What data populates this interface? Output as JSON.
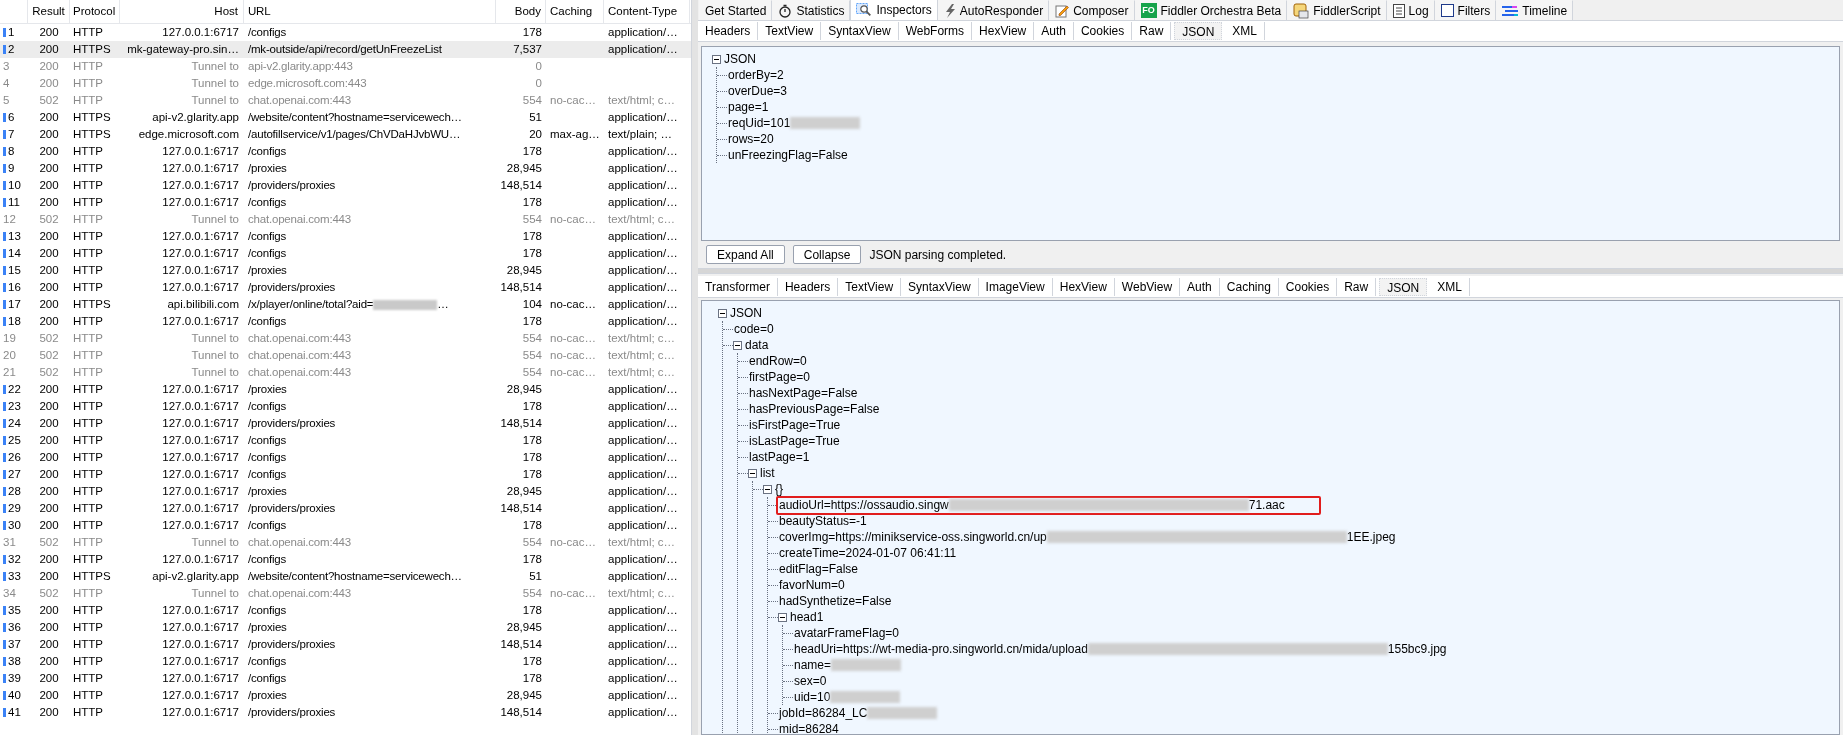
{
  "sessions": {
    "columns": [
      {
        "kind": "num"
      },
      {
        "kind": "result",
        "label": "Result"
      },
      {
        "kind": "protocol",
        "label": "Protocol"
      },
      {
        "kind": "host",
        "label": "Host"
      },
      {
        "kind": "url",
        "label": "URL"
      },
      {
        "kind": "body",
        "label": "Body"
      },
      {
        "kind": "caching",
        "label": "Caching"
      },
      {
        "kind": "content_type",
        "label": "Content-Type"
      }
    ],
    "rows": [
      {
        "num": "1",
        "result": "200",
        "protocol": "HTTP",
        "host": "127.0.0.1:6717",
        "url": "/configs",
        "body": "178",
        "caching": "",
        "content_type": "application/…",
        "kind": "normal",
        "selected": false
      },
      {
        "num": "2",
        "result": "200",
        "protocol": "HTTPS",
        "host": "mk-gateway-pro.sin…",
        "url": "/mk-outside/api/record/getUnFreezeList",
        "body": "7,537",
        "caching": "",
        "content_type": "application/…",
        "kind": "normal",
        "selected": true
      },
      {
        "num": "3",
        "result": "200",
        "protocol": "HTTP",
        "host": "Tunnel to",
        "url": "api-v2.glarity.app:443",
        "body": "0",
        "caching": "",
        "content_type": "",
        "kind": "tunnel",
        "selected": false
      },
      {
        "num": "4",
        "result": "200",
        "protocol": "HTTP",
        "host": "Tunnel to",
        "url": "edge.microsoft.com:443",
        "body": "0",
        "caching": "",
        "content_type": "",
        "kind": "tunnel",
        "selected": false
      },
      {
        "num": "5",
        "result": "502",
        "protocol": "HTTP",
        "host": "Tunnel to",
        "url": "chat.openai.com:443",
        "body": "554",
        "caching": "no-cac…",
        "content_type": "text/html; c…",
        "kind": "tunnel",
        "selected": false
      },
      {
        "num": "6",
        "result": "200",
        "protocol": "HTTPS",
        "host": "api-v2.glarity.app",
        "url": "/website/content?hostname=servicewech…",
        "body": "51",
        "caching": "",
        "content_type": "application/…",
        "kind": "normal",
        "selected": false
      },
      {
        "num": "7",
        "result": "200",
        "protocol": "HTTPS",
        "host": "edge.microsoft.com",
        "url": "/autofillservice/v1/pages/ChVDaHJvbWU…",
        "body": "20",
        "caching": "max-ag…",
        "content_type": "text/plain; …",
        "kind": "normal",
        "selected": false
      },
      {
        "num": "8",
        "result": "200",
        "protocol": "HTTP",
        "host": "127.0.0.1:6717",
        "url": "/configs",
        "body": "178",
        "caching": "",
        "content_type": "application/…",
        "kind": "normal",
        "selected": false
      },
      {
        "num": "9",
        "result": "200",
        "protocol": "HTTP",
        "host": "127.0.0.1:6717",
        "url": "/proxies",
        "body": "28,945",
        "caching": "",
        "content_type": "application/…",
        "kind": "normal",
        "selected": false
      },
      {
        "num": "10",
        "result": "200",
        "protocol": "HTTP",
        "host": "127.0.0.1:6717",
        "url": "/providers/proxies",
        "body": "148,514",
        "caching": "",
        "content_type": "application/…",
        "kind": "normal",
        "selected": false
      },
      {
        "num": "11",
        "result": "200",
        "protocol": "HTTP",
        "host": "127.0.0.1:6717",
        "url": "/configs",
        "body": "178",
        "caching": "",
        "content_type": "application/…",
        "kind": "normal",
        "selected": false
      },
      {
        "num": "12",
        "result": "502",
        "protocol": "HTTP",
        "host": "Tunnel to",
        "url": "chat.openai.com:443",
        "body": "554",
        "caching": "no-cac…",
        "content_type": "text/html; c…",
        "kind": "tunnel",
        "selected": false
      },
      {
        "num": "13",
        "result": "200",
        "protocol": "HTTP",
        "host": "127.0.0.1:6717",
        "url": "/configs",
        "body": "178",
        "caching": "",
        "content_type": "application/…",
        "kind": "normal",
        "selected": false
      },
      {
        "num": "14",
        "result": "200",
        "protocol": "HTTP",
        "host": "127.0.0.1:6717",
        "url": "/configs",
        "body": "178",
        "caching": "",
        "content_type": "application/…",
        "kind": "normal",
        "selected": false
      },
      {
        "num": "15",
        "result": "200",
        "protocol": "HTTP",
        "host": "127.0.0.1:6717",
        "url": "/proxies",
        "body": "28,945",
        "caching": "",
        "content_type": "application/…",
        "kind": "normal",
        "selected": false
      },
      {
        "num": "16",
        "result": "200",
        "protocol": "HTTP",
        "host": "127.0.0.1:6717",
        "url": "/providers/proxies",
        "body": "148,514",
        "caching": "",
        "content_type": "application/…",
        "kind": "normal",
        "selected": false
      },
      {
        "num": "17",
        "result": "200",
        "protocol": "HTTPS",
        "host": "api.bilibili.com",
        "url": "/x/player/online/total?aid=",
        "url_tail": "…",
        "body": "104",
        "caching": "no-cac…",
        "content_type": "application/…",
        "kind": "normal",
        "selected": false
      },
      {
        "num": "18",
        "result": "200",
        "protocol": "HTTP",
        "host": "127.0.0.1:6717",
        "url": "/configs",
        "body": "178",
        "caching": "",
        "content_type": "application/…",
        "kind": "normal",
        "selected": false
      },
      {
        "num": "19",
        "result": "502",
        "protocol": "HTTP",
        "host": "Tunnel to",
        "url": "chat.openai.com:443",
        "body": "554",
        "caching": "no-cac…",
        "content_type": "text/html; c…",
        "kind": "tunnel",
        "selected": false
      },
      {
        "num": "20",
        "result": "502",
        "protocol": "HTTP",
        "host": "Tunnel to",
        "url": "chat.openai.com:443",
        "body": "554",
        "caching": "no-cac…",
        "content_type": "text/html; c…",
        "kind": "tunnel",
        "selected": false
      },
      {
        "num": "21",
        "result": "502",
        "protocol": "HTTP",
        "host": "Tunnel to",
        "url": "chat.openai.com:443",
        "body": "554",
        "caching": "no-cac…",
        "content_type": "text/html; c…",
        "kind": "tunnel",
        "selected": false
      },
      {
        "num": "22",
        "result": "200",
        "protocol": "HTTP",
        "host": "127.0.0.1:6717",
        "url": "/proxies",
        "body": "28,945",
        "caching": "",
        "content_type": "application/…",
        "kind": "normal",
        "selected": false
      },
      {
        "num": "23",
        "result": "200",
        "protocol": "HTTP",
        "host": "127.0.0.1:6717",
        "url": "/configs",
        "body": "178",
        "caching": "",
        "content_type": "application/…",
        "kind": "normal",
        "selected": false
      },
      {
        "num": "24",
        "result": "200",
        "protocol": "HTTP",
        "host": "127.0.0.1:6717",
        "url": "/providers/proxies",
        "body": "148,514",
        "caching": "",
        "content_type": "application/…",
        "kind": "normal",
        "selected": false
      },
      {
        "num": "25",
        "result": "200",
        "protocol": "HTTP",
        "host": "127.0.0.1:6717",
        "url": "/configs",
        "body": "178",
        "caching": "",
        "content_type": "application/…",
        "kind": "normal",
        "selected": false
      },
      {
        "num": "26",
        "result": "200",
        "protocol": "HTTP",
        "host": "127.0.0.1:6717",
        "url": "/configs",
        "body": "178",
        "caching": "",
        "content_type": "application/…",
        "kind": "normal",
        "selected": false
      },
      {
        "num": "27",
        "result": "200",
        "protocol": "HTTP",
        "host": "127.0.0.1:6717",
        "url": "/configs",
        "body": "178",
        "caching": "",
        "content_type": "application/…",
        "kind": "normal",
        "selected": false
      },
      {
        "num": "28",
        "result": "200",
        "protocol": "HTTP",
        "host": "127.0.0.1:6717",
        "url": "/proxies",
        "body": "28,945",
        "caching": "",
        "content_type": "application/…",
        "kind": "normal",
        "selected": false
      },
      {
        "num": "29",
        "result": "200",
        "protocol": "HTTP",
        "host": "127.0.0.1:6717",
        "url": "/providers/proxies",
        "body": "148,514",
        "caching": "",
        "content_type": "application/…",
        "kind": "normal",
        "selected": false
      },
      {
        "num": "30",
        "result": "200",
        "protocol": "HTTP",
        "host": "127.0.0.1:6717",
        "url": "/configs",
        "body": "178",
        "caching": "",
        "content_type": "application/…",
        "kind": "normal",
        "selected": false
      },
      {
        "num": "31",
        "result": "502",
        "protocol": "HTTP",
        "host": "Tunnel to",
        "url": "chat.openai.com:443",
        "body": "554",
        "caching": "no-cac…",
        "content_type": "text/html; c…",
        "kind": "tunnel",
        "selected": false
      },
      {
        "num": "32",
        "result": "200",
        "protocol": "HTTP",
        "host": "127.0.0.1:6717",
        "url": "/configs",
        "body": "178",
        "caching": "",
        "content_type": "application/…",
        "kind": "normal",
        "selected": false
      },
      {
        "num": "33",
        "result": "200",
        "protocol": "HTTPS",
        "host": "api-v2.glarity.app",
        "url": "/website/content?hostname=servicewech…",
        "body": "51",
        "caching": "",
        "content_type": "application/…",
        "kind": "normal",
        "selected": false
      },
      {
        "num": "34",
        "result": "502",
        "protocol": "HTTP",
        "host": "Tunnel to",
        "url": "chat.openai.com:443",
        "body": "554",
        "caching": "no-cac…",
        "content_type": "text/html; c…",
        "kind": "tunnel",
        "selected": false
      },
      {
        "num": "35",
        "result": "200",
        "protocol": "HTTP",
        "host": "127.0.0.1:6717",
        "url": "/configs",
        "body": "178",
        "caching": "",
        "content_type": "application/…",
        "kind": "normal",
        "selected": false
      },
      {
        "num": "36",
        "result": "200",
        "protocol": "HTTP",
        "host": "127.0.0.1:6717",
        "url": "/proxies",
        "body": "28,945",
        "caching": "",
        "content_type": "application/…",
        "kind": "normal",
        "selected": false
      },
      {
        "num": "37",
        "result": "200",
        "protocol": "HTTP",
        "host": "127.0.0.1:6717",
        "url": "/providers/proxies",
        "body": "148,514",
        "caching": "",
        "content_type": "application/…",
        "kind": "normal",
        "selected": false
      },
      {
        "num": "38",
        "result": "200",
        "protocol": "HTTP",
        "host": "127.0.0.1:6717",
        "url": "/configs",
        "body": "178",
        "caching": "",
        "content_type": "application/…",
        "kind": "normal",
        "selected": false
      },
      {
        "num": "39",
        "result": "200",
        "protocol": "HTTP",
        "host": "127.0.0.1:6717",
        "url": "/configs",
        "body": "178",
        "caching": "",
        "content_type": "application/…",
        "kind": "normal",
        "selected": false
      },
      {
        "num": "40",
        "result": "200",
        "protocol": "HTTP",
        "host": "127.0.0.1:6717",
        "url": "/proxies",
        "body": "28,945",
        "caching": "",
        "content_type": "application/…",
        "kind": "normal",
        "selected": false
      },
      {
        "num": "41",
        "result": "200",
        "protocol": "HTTP",
        "host": "127.0.0.1:6717",
        "url": "/providers/proxies",
        "body": "148,514",
        "caching": "",
        "content_type": "application/…",
        "kind": "normal",
        "selected": false
      }
    ]
  },
  "main_tabs": [
    {
      "label": "Get Started",
      "selected": false
    },
    {
      "label": "Statistics",
      "selected": false
    },
    {
      "label": "Inspectors",
      "selected": true
    },
    {
      "label": "AutoResponder",
      "selected": false
    },
    {
      "label": "Composer",
      "selected": false
    },
    {
      "label": "Fiddler Orchestra Beta",
      "badge": "FO",
      "selected": false
    },
    {
      "label": "FiddlerScript",
      "selected": false
    },
    {
      "label": "Log",
      "selected": false
    },
    {
      "label": "Filters",
      "selected": false
    },
    {
      "label": "Timeline",
      "selected": false
    }
  ],
  "request": {
    "tabs": [
      {
        "label": "Headers",
        "selected": false
      },
      {
        "label": "TextView",
        "selected": false
      },
      {
        "label": "SyntaxView",
        "selected": false
      },
      {
        "label": "WebForms",
        "selected": false
      },
      {
        "label": "HexView",
        "selected": false
      },
      {
        "label": "Auth",
        "selected": false
      },
      {
        "label": "Cookies",
        "selected": false
      },
      {
        "label": "Raw",
        "selected": false
      },
      {
        "label": "JSON",
        "selected": true
      },
      {
        "label": "XML",
        "selected": false
      }
    ],
    "tree": {
      "text": "JSON",
      "expanded": true,
      "children": [
        {
          "text": "orderBy=2"
        },
        {
          "text": "overDue=3"
        },
        {
          "text": "page=1"
        },
        {
          "text": "reqUid=101",
          "redacted": true
        },
        {
          "text": "rows=20"
        },
        {
          "text": "unFreezingFlag=False"
        }
      ]
    },
    "buttons": [
      "Expand All",
      "Collapse"
    ],
    "status": "JSON parsing completed."
  },
  "response": {
    "tabs": [
      {
        "label": "Transformer",
        "selected": false
      },
      {
        "label": "Headers",
        "selected": false
      },
      {
        "label": "TextView",
        "selected": false
      },
      {
        "label": "SyntaxView",
        "selected": false
      },
      {
        "label": "ImageView",
        "selected": false
      },
      {
        "label": "HexView",
        "selected": false
      },
      {
        "label": "WebView",
        "selected": false
      },
      {
        "label": "Auth",
        "selected": false
      },
      {
        "label": "Caching",
        "selected": false
      },
      {
        "label": "Cookies",
        "selected": false
      },
      {
        "label": "Raw",
        "selected": false
      },
      {
        "label": "JSON",
        "selected": true
      },
      {
        "label": "XML",
        "selected": false
      }
    ],
    "tree": {
      "text": "JSON",
      "expanded": true,
      "children": [
        {
          "text": "code=0"
        },
        {
          "text": "data",
          "expanded": true,
          "children": [
            {
              "text": "endRow=0"
            },
            {
              "text": "firstPage=0"
            },
            {
              "text": "hasNextPage=False"
            },
            {
              "text": "hasPreviousPage=False"
            },
            {
              "text": "isFirstPage=True"
            },
            {
              "text": "isLastPage=True"
            },
            {
              "text": "lastPage=1"
            },
            {
              "text": "list",
              "expanded": true,
              "children": [
                {
                  "text": "{}",
                  "expanded": true,
                  "children": [
                    {
                      "text": "audioUrl=https://ossaudio.singw",
                      "redacted": true,
                      "tail": "71.aac",
                      "highlighted": true
                    },
                    {
                      "text": "beautyStatus=-1",
                      "highlighted": false
                    },
                    {
                      "text": "coverImg=https://minikservice-oss.singworld.cn/up",
                      "redacted": true,
                      "tail": "1EE.jpeg",
                      "highlighted": false
                    },
                    {
                      "text": "createTime=2024-01-07 06:41:11",
                      "highlighted": false
                    },
                    {
                      "text": "editFlag=False",
                      "highlighted": false
                    },
                    {
                      "text": "favorNum=0",
                      "highlighted": false
                    },
                    {
                      "text": "hadSynthetize=False",
                      "highlighted": false
                    },
                    {
                      "text": "head1",
                      "expanded": true,
                      "highlighted": false,
                      "children": [
                        {
                          "text": "avatarFrameFlag=0"
                        },
                        {
                          "text": "headUri=https://wt-media-pro.singworld.cn/mida/upload",
                          "redacted": true,
                          "tail": "155bc9.jpg"
                        },
                        {
                          "text": "name=",
                          "redacted": true
                        },
                        {
                          "text": "sex=0"
                        },
                        {
                          "text": "uid=10",
                          "redacted": true
                        }
                      ]
                    },
                    {
                      "text": "jobId=86284_LC",
                      "redacted": true,
                      "highlighted": false
                    },
                    {
                      "text": "mid=86284",
                      "highlighted": false
                    }
                  ]
                }
              ]
            }
          ]
        }
      ]
    }
  }
}
